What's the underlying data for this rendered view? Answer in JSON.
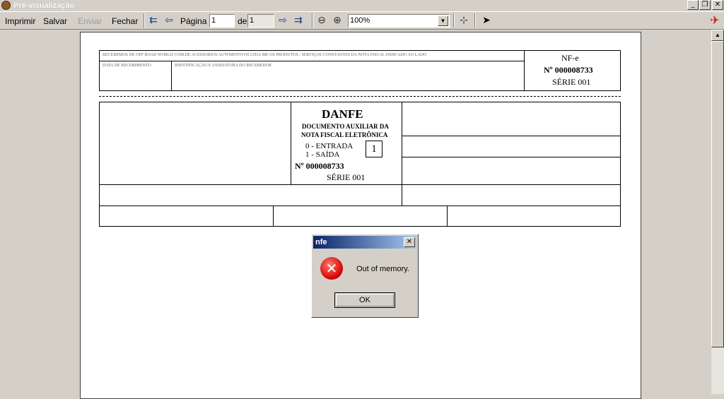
{
  "window": {
    "title": "Pré-visualização",
    "controls": {
      "minimize": "_",
      "restore": "❐",
      "close": "✕"
    }
  },
  "toolbar": {
    "print_label": "Imprimir",
    "save_label": "Salvar",
    "send_label": "Enviar",
    "close_label": "Fechar",
    "page_label": "Página",
    "page_value": "1",
    "of_label": "de",
    "total_pages": "1",
    "zoom_value": "100%",
    "icons": [
      "first-page-icon",
      "prev-page-icon",
      "next-page-icon",
      "last-page-icon",
      "zoom-out-icon",
      "zoom-in-icon",
      "page-width-icon",
      "pointer-icon",
      "app-logo-icon"
    ]
  },
  "document": {
    "receipt_text": "RECEBEMOS DE OFF ROAD WORLD COM.DE ACESSORIOS AUTOMOTIVOS LTDA ME OS PRODUTOS / SERVIÇOS CONSTANTES DA NOTA FISCAL INDICADO AO LADO",
    "date_label": "DATA DE RECEBIMENTO",
    "signature_label": "IDENTIFICAÇÃO E ASSINATURA DO RECEBEDOR",
    "nfe_label": "NF-e",
    "nfe_number": "Nº 000008733",
    "nfe_series": "SÉRIE 001",
    "danfe_title": "DANFE",
    "danfe_subtitle_1": "DOCUMENTO AUXILIAR DA",
    "danfe_subtitle_2": "NOTA FISCAL ELETRÔNICA",
    "entry_label": "0 - ENTRADA",
    "exit_label": "1 - SAÍDA",
    "operation_type": "1",
    "danfe_number": "Nº 000008733",
    "danfe_series": "SÉRIE 001"
  },
  "dialog": {
    "title": "nfe",
    "message": "Out of memory.",
    "ok_label": "OK",
    "close_glyph": "✕",
    "icon_glyph": "✕",
    "icon": "error-icon"
  },
  "scrollbar": {
    "up_glyph": "▲"
  },
  "colors": {
    "dialog_title": "#0a246a",
    "error_icon": "#d40000",
    "chrome": "#d4d0c8"
  }
}
